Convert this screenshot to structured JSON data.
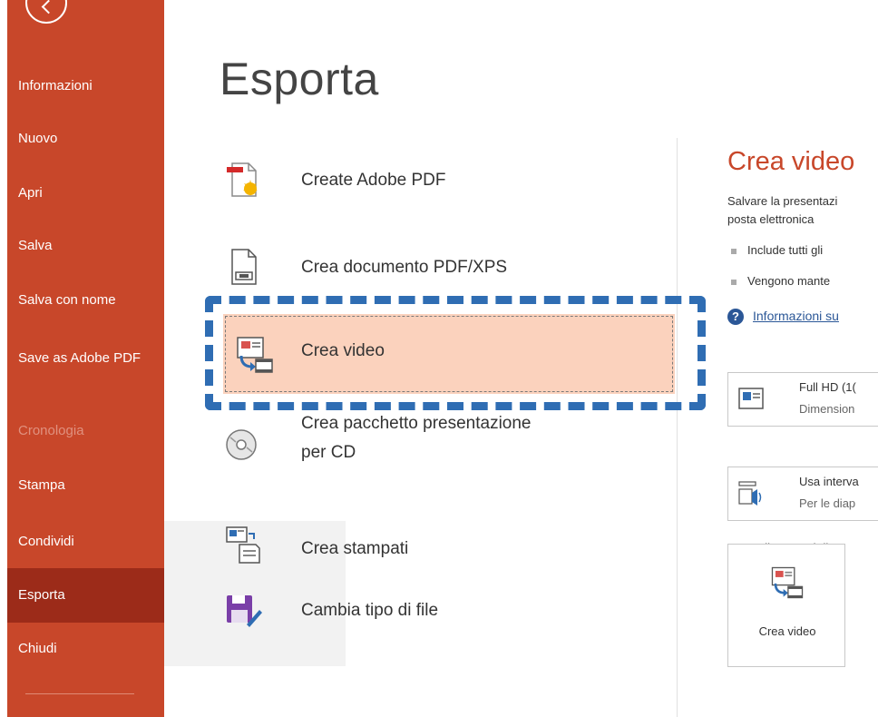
{
  "sidebar": {
    "items": [
      {
        "label": "Informazioni"
      },
      {
        "label": "Nuovo"
      },
      {
        "label": "Apri"
      },
      {
        "label": "Salva"
      },
      {
        "label": "Salva con nome"
      },
      {
        "label": "Save as Adobe PDF"
      },
      {
        "label": "Cronologia"
      },
      {
        "label": "Stampa"
      },
      {
        "label": "Condividi"
      },
      {
        "label": "Esporta"
      },
      {
        "label": "Chiudi"
      }
    ],
    "active": "Esporta",
    "disabled": "Cronologia"
  },
  "page": {
    "title": "Esporta"
  },
  "options": [
    {
      "label": "Create Adobe PDF",
      "icon": "adobe-pdf-icon"
    },
    {
      "label": "Crea documento PDF/XPS",
      "icon": "pdf-xps-document-icon"
    },
    {
      "label": "Crea video",
      "icon": "video-icon"
    },
    {
      "label": "Crea pacchetto presentazione",
      "label2": "per CD",
      "icon": "cd-icon"
    },
    {
      "label": "Crea stampati",
      "icon": "handouts-icon"
    },
    {
      "label": "Cambia tipo di file",
      "icon": "save-file-type-icon"
    }
  ],
  "selected_option": "Crea video",
  "right_panel": {
    "title": "Crea video",
    "description_l1": "Salvare la presentazi",
    "description_l2": "posta elettronica",
    "bullets": [
      "Include tutti gli",
      "Vengono mante"
    ],
    "help_link": "Informazioni su",
    "quality_dropdown": {
      "line1": "Full HD (1(",
      "line2": "Dimension"
    },
    "timing_dropdown": {
      "line1": "Usa interva",
      "line2": "Per le diap"
    },
    "seconds_label": "Secondi per ogni dia",
    "create_button": "Crea video"
  },
  "colors": {
    "accent": "#c8472a",
    "active_nav": "#9c2b19",
    "selected_bg": "#fbd2bd",
    "focus": "#2f6db3",
    "link": "#2b5797"
  }
}
